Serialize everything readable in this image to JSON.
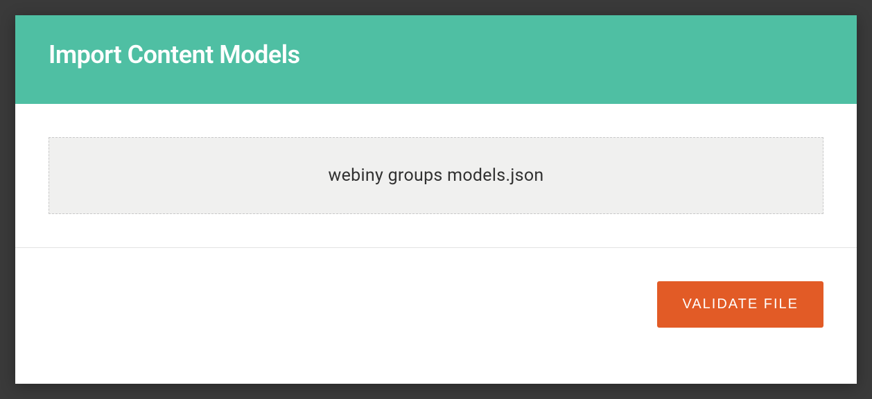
{
  "modal": {
    "title": "Import Content Models",
    "dropzone": {
      "filename": "webiny groups models.json"
    },
    "actions": {
      "validate_label": "VALIDATE FILE"
    }
  }
}
